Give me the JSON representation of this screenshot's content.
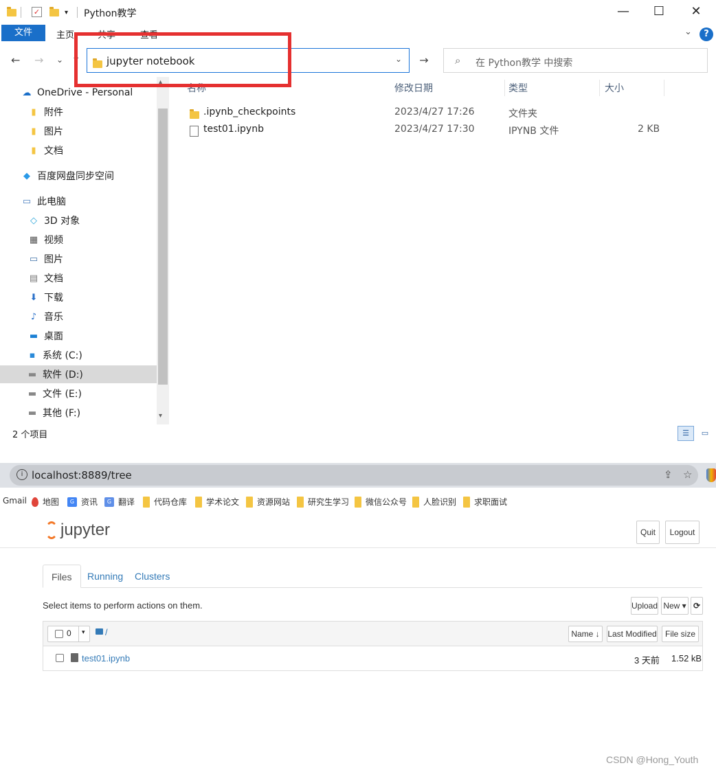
{
  "explorer": {
    "window_title": "Python教学",
    "ribbon": {
      "file": "文件",
      "home": "主页",
      "share": "共享",
      "view": "查看"
    },
    "nav": {
      "back": "←",
      "forward": "→",
      "recent": "⌄",
      "up": "↑"
    },
    "address": "jupyter notebook",
    "search_placeholder": "在 Python教学 中搜索",
    "sidebar": [
      {
        "label": "OneDrive - Personal",
        "icon": "cloud-icon"
      },
      {
        "label": "附件",
        "icon": "folder-icon"
      },
      {
        "label": "图片",
        "icon": "folder-icon"
      },
      {
        "label": "文档",
        "icon": "folder-icon"
      },
      {
        "label": "百度网盘同步空间",
        "icon": "baidu-cloud-icon"
      },
      {
        "label": "此电脑",
        "icon": "computer-icon"
      },
      {
        "label": "3D 对象",
        "icon": "3d-objects-icon"
      },
      {
        "label": "视频",
        "icon": "video-icon"
      },
      {
        "label": "图片",
        "icon": "pictures-icon"
      },
      {
        "label": "文档",
        "icon": "documents-icon"
      },
      {
        "label": "下载",
        "icon": "download-icon"
      },
      {
        "label": "音乐",
        "icon": "music-icon"
      },
      {
        "label": "桌面",
        "icon": "desktop-icon"
      },
      {
        "label": "系统 (C:)",
        "icon": "system-drive-icon"
      },
      {
        "label": "软件 (D:)",
        "icon": "drive-icon"
      },
      {
        "label": "文件 (E:)",
        "icon": "drive-icon"
      },
      {
        "label": "其他 (F:)",
        "icon": "drive-icon"
      }
    ],
    "columns": {
      "name": "名称",
      "modified": "修改日期",
      "type": "类型",
      "size": "大小"
    },
    "files": [
      {
        "name": ".ipynb_checkpoints",
        "modified": "2023/4/27 17:26",
        "type": "文件夹",
        "size": ""
      },
      {
        "name": "test01.ipynb",
        "modified": "2023/4/27 17:30",
        "type": "IPYNB 文件",
        "size": "2 KB"
      }
    ],
    "status": "2 个项目",
    "accent_color": "#1a6fc9",
    "highlight_color": "#e53030"
  },
  "browser": {
    "url": "localhost:8889/tree",
    "bookmarks": [
      "Gmail",
      "地图",
      "资讯",
      "翻译",
      "代码仓库",
      "学术论文",
      "资源网站",
      "研究生学习",
      "微信公众号",
      "人脸识别",
      "求职面试"
    ],
    "jupyter": {
      "logo": "jupyter",
      "quit": "Quit",
      "logout": "Logout",
      "tabs": [
        "Files",
        "Running",
        "Clusters"
      ],
      "hint": "Select items to perform actions on them.",
      "upload": "Upload",
      "new": "New ▾",
      "refresh": "⟳",
      "selected_count": "0",
      "path": "/",
      "sort_name": "Name ↓",
      "sort_modified": "Last Modified",
      "sort_size": "File size",
      "files": [
        {
          "name": "test01.ipynb",
          "modified": "3 天前",
          "size": "1.52 kB"
        }
      ]
    }
  },
  "watermark": "CSDN @Hong_Youth"
}
